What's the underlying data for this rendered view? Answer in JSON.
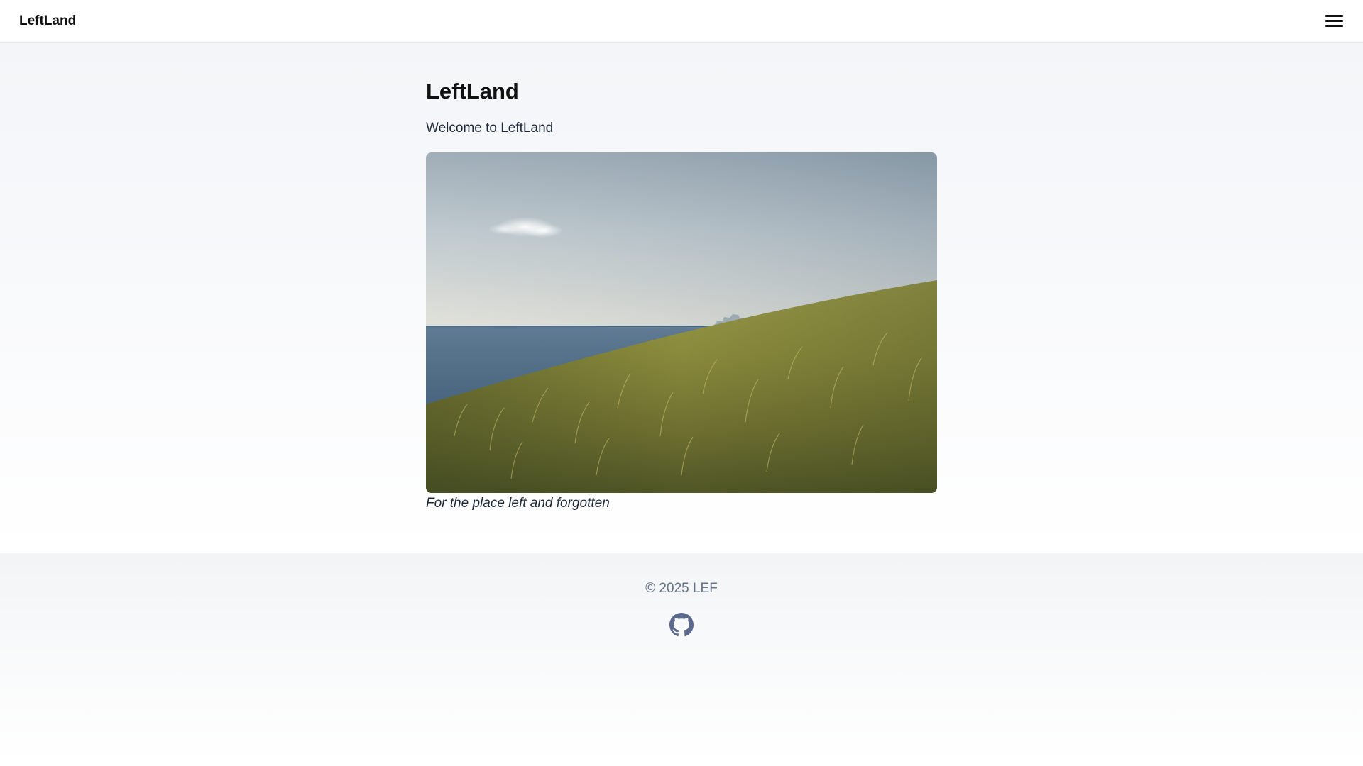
{
  "header": {
    "brand": "LeftLand",
    "menu_icon": "hamburger-menu-icon"
  },
  "main": {
    "title": "LeftLand",
    "welcome": "Welcome to LeftLand",
    "image_caption": "For the place left and forgotten"
  },
  "footer": {
    "copyright": "© 2025 LEF",
    "social_icon": "github-icon"
  },
  "colors": {
    "text_primary": "#111111",
    "text_muted": "#64748b",
    "github_icon": "#5b6a8c"
  }
}
